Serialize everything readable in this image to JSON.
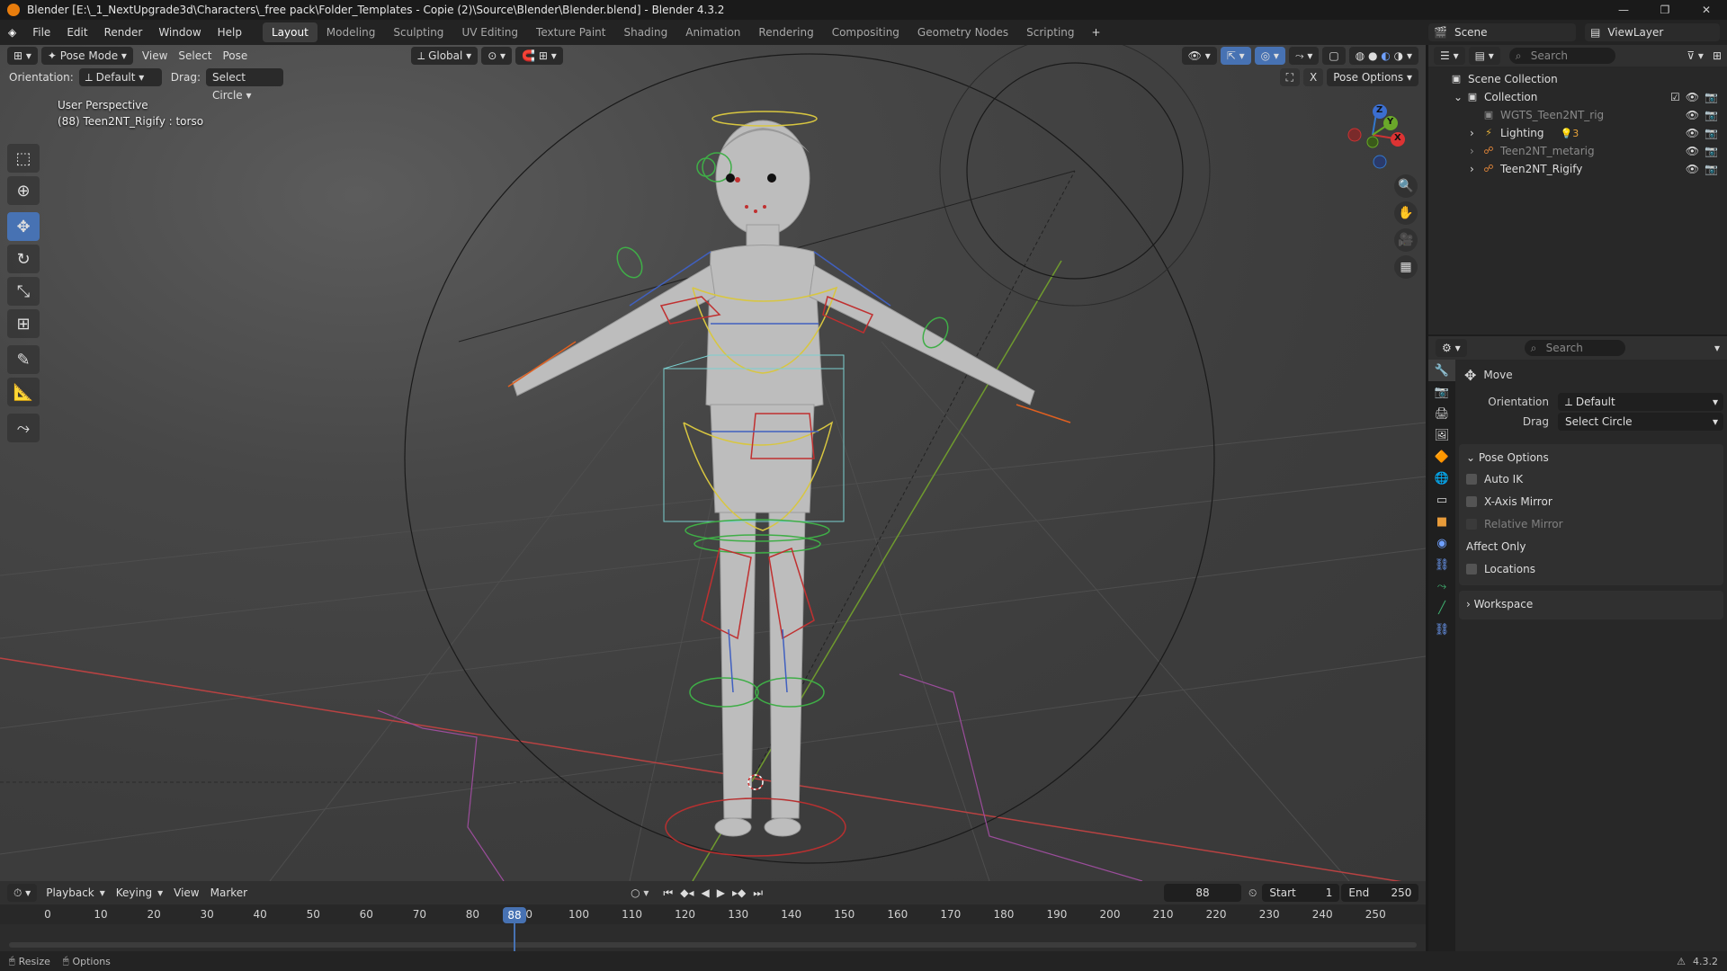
{
  "title_bar": {
    "title": "Blender [E:\\_1_NextUpgrade3d\\Characters\\_free pack\\Folder_Templates - Copie (2)\\Source\\Blender\\Blender.blend] - Blender 4.3.2",
    "minimize": "—",
    "maximize": "❐",
    "close": "✕"
  },
  "menu": [
    "File",
    "Edit",
    "Render",
    "Window",
    "Help"
  ],
  "workspaces": [
    {
      "label": "Layout",
      "active": true
    },
    {
      "label": "Modeling"
    },
    {
      "label": "Sculpting"
    },
    {
      "label": "UV Editing"
    },
    {
      "label": "Texture Paint"
    },
    {
      "label": "Shading"
    },
    {
      "label": "Animation"
    },
    {
      "label": "Rendering"
    },
    {
      "label": "Compositing"
    },
    {
      "label": "Geometry Nodes"
    },
    {
      "label": "Scripting"
    }
  ],
  "add_workspace": "+",
  "scene": {
    "name": "Scene",
    "view_layer": "ViewLayer"
  },
  "viewport": {
    "mode": "Pose Mode",
    "menus": [
      "View",
      "Select",
      "Pose"
    ],
    "transform_orientation": "Global",
    "orientation_label": "Orientation:",
    "orientation_value": "Default",
    "drag_label": "Drag:",
    "drag_value": "Select Circle",
    "pose_options": "Pose Options",
    "info_line1": "User Perspective",
    "info_line2": "(88) Teen2NT_Rigify : torso",
    "gizmo": {
      "x": "X",
      "y": "Y",
      "z": "Z"
    },
    "close_x": "X"
  },
  "tools": [
    {
      "name": "select-tool",
      "glyph": "⬚"
    },
    {
      "name": "cursor-tool",
      "glyph": "⊕"
    },
    {
      "name": "move-tool",
      "glyph": "✥",
      "active": true
    },
    {
      "name": "rotate-tool",
      "glyph": "↻"
    },
    {
      "name": "scale-tool",
      "glyph": "⤡"
    },
    {
      "name": "transform-tool",
      "glyph": "⊞"
    },
    {
      "name": "annotate-tool",
      "glyph": "✎"
    },
    {
      "name": "measure-tool",
      "glyph": "📐"
    },
    {
      "name": "bone-tool",
      "glyph": "⤳"
    }
  ],
  "outliner": {
    "search_placeholder": "Search",
    "rows": [
      {
        "label": "Scene Collection",
        "indent": 0,
        "icon": "▣"
      },
      {
        "label": "Collection",
        "indent": 1,
        "icon": "▣",
        "expand": "⌄"
      },
      {
        "label": "WGTS_Teen2NT_rig",
        "indent": 2,
        "icon": "▣",
        "dim": true
      },
      {
        "label": "Lighting",
        "indent": 2,
        "icon": "⚡",
        "expand": "›",
        "extra": "💡3"
      },
      {
        "label": "Teen2NT_metarig",
        "indent": 2,
        "icon": "☍",
        "expand": "›",
        "dim": true
      },
      {
        "label": "Teen2NT_Rigify",
        "indent": 2,
        "icon": "☍",
        "expand": "›"
      }
    ]
  },
  "properties": {
    "search_placeholder": "Search",
    "tool_name": "Move",
    "orientation_label": "Orientation",
    "orientation_value": "Default",
    "drag_label": "Drag",
    "drag_value": "Select Circle",
    "pose_options_title": "Pose Options",
    "checks": [
      {
        "label": "Auto IK",
        "dim": false
      },
      {
        "label": "X-Axis Mirror",
        "dim": false
      },
      {
        "label": "Relative Mirror",
        "dim": true
      }
    ],
    "affect_only": "Affect Only",
    "locations": "Locations",
    "workspace_title": "Workspace"
  },
  "timeline": {
    "menus": [
      "Playback",
      "Keying",
      "View",
      "Marker"
    ],
    "current_frame": "88",
    "start_label": "Start",
    "start_value": "1",
    "end_label": "End",
    "end_value": "250",
    "ticks": [
      "0",
      "10",
      "20",
      "30",
      "40",
      "50",
      "60",
      "70",
      "80",
      "90",
      "100",
      "110",
      "120",
      "130",
      "140",
      "150",
      "160",
      "170",
      "180",
      "190",
      "200",
      "210",
      "220",
      "230",
      "240",
      "250"
    ],
    "playhead": "88"
  },
  "status": {
    "resize": "Resize",
    "options": "Options",
    "version": "4.3.2"
  }
}
